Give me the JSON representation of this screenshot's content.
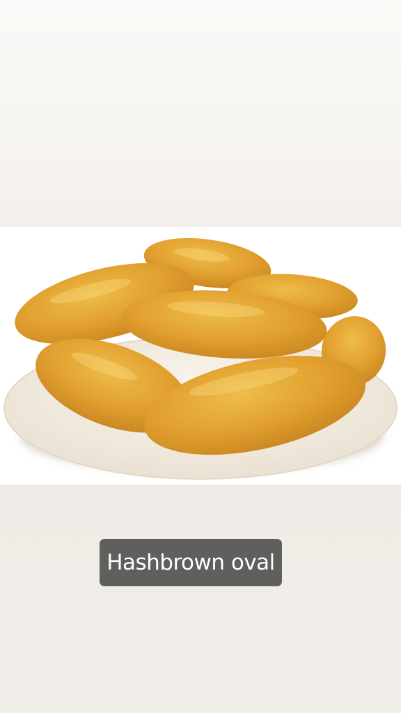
{
  "story": {
    "caption": "Hashbrown oval"
  },
  "photo": {
    "subject": "hashbrown-plate",
    "colors": {
      "background": "#ffffff",
      "plate": "#f3ede2",
      "hashbrown_base": "#e9a12a",
      "hashbrown_highlight": "#f6c24a",
      "hashbrown_shadow": "#c97e17",
      "caption_background": "#5f5f5d",
      "caption_text": "#ffffff",
      "page_background": "#f1ede8"
    }
  }
}
